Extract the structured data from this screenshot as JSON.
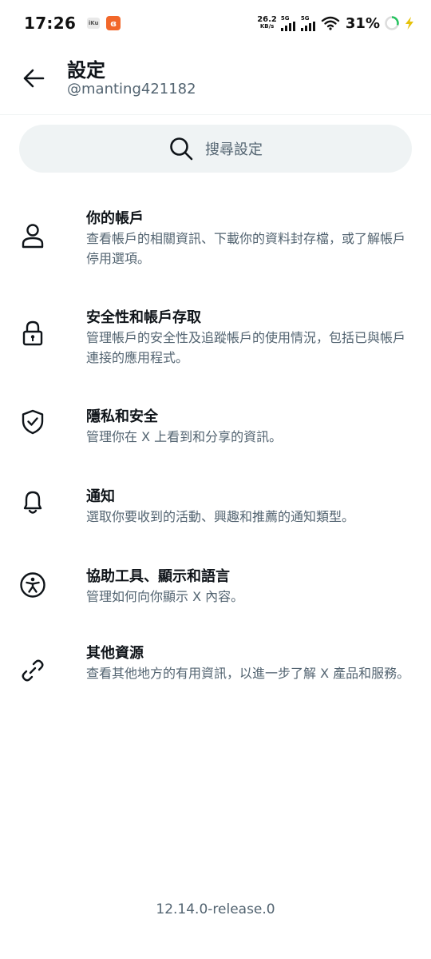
{
  "status_bar": {
    "time": "17:26",
    "app1_label": "iKu",
    "net_speed_value": "26.2",
    "net_speed_unit": "KB/s",
    "sim1": "5G",
    "sim2": "5G",
    "battery": "31%"
  },
  "header": {
    "title": "設定",
    "handle": "@manting421182"
  },
  "search": {
    "placeholder": "搜尋設定"
  },
  "items": [
    {
      "icon": "person-icon",
      "title": "你的帳戶",
      "description": "查看帳戶的相關資訊、下載你的資料封存檔，或了解帳戶停用選項。"
    },
    {
      "icon": "lock-icon",
      "title": "安全性和帳戶存取",
      "description": "管理帳戶的安全性及追蹤帳戶的使用情況，包括已與帳戶連接的應用程式。"
    },
    {
      "icon": "shield-icon",
      "title": "隱私和安全",
      "description": "管理你在 X 上看到和分享的資訊。"
    },
    {
      "icon": "bell-icon",
      "title": "通知",
      "description": "選取你要收到的活動、興趣和推薦的通知類型。"
    },
    {
      "icon": "accessibility-icon",
      "title": "協助工具、顯示和語言",
      "description": "管理如何向你顯示 X 內容。"
    },
    {
      "icon": "link-icon",
      "title": "其他資源",
      "description": "查看其他地方的有用資訊，以進一步了解 X 產品和服務。"
    }
  ],
  "version": "12.14.0-release.0",
  "colors": {
    "primary_text": "#0f1419",
    "secondary_text": "#536471",
    "search_bg": "#eff3f4",
    "battery_ring": "#25c35f",
    "charging_bolt": "#e6c20a"
  }
}
